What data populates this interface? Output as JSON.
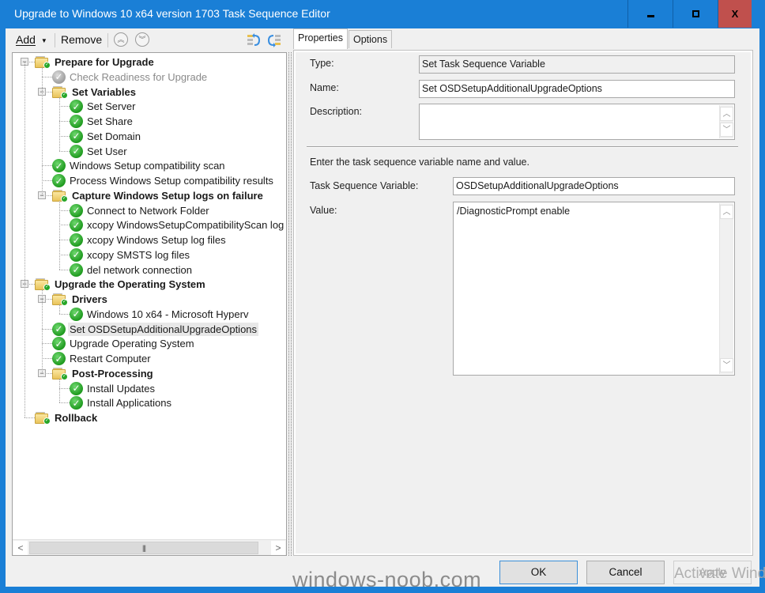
{
  "window": {
    "title": "Upgrade to Windows 10 x64 version 1703 Task Sequence Editor",
    "controls": {
      "minimize": "_",
      "maximize": "□",
      "close": "X"
    },
    "accent_color": "#1a7fd6",
    "close_color": "#c0504d"
  },
  "toolbar": {
    "add_label": "Add",
    "add_mnemonic": "A",
    "remove_label": "Remove",
    "remove_mnemonic": "R",
    "move_up_icon": "move-up-circle-icon",
    "move_down_icon": "move-down-circle-icon",
    "expand_icon": "expand-all-icon",
    "collapse_icon": "collapse-all-icon"
  },
  "tree": {
    "items": [
      {
        "label": "Prepare for Upgrade",
        "type": "group",
        "level": 0,
        "expanded": true
      },
      {
        "label": "Check Readiness for Upgrade",
        "type": "step",
        "level": 1,
        "disabled": true
      },
      {
        "label": "Set Variables",
        "type": "group",
        "level": 1,
        "expanded": true
      },
      {
        "label": "Set Server",
        "type": "step",
        "level": 2
      },
      {
        "label": "Set Share",
        "type": "step",
        "level": 2
      },
      {
        "label": "Set Domain",
        "type": "step",
        "level": 2
      },
      {
        "label": "Set User",
        "type": "step",
        "level": 2
      },
      {
        "label": "Windows Setup compatibility scan",
        "type": "step",
        "level": 1
      },
      {
        "label": "Process Windows Setup compatibility results",
        "type": "step",
        "level": 1
      },
      {
        "label": "Capture Windows Setup logs on failure",
        "type": "group",
        "level": 1,
        "expanded": true
      },
      {
        "label": "Connect to Network Folder",
        "type": "step",
        "level": 2
      },
      {
        "label": "xcopy WindowsSetupCompatibilityScan log files",
        "type": "step",
        "level": 2
      },
      {
        "label": "xcopy Windows Setup log files",
        "type": "step",
        "level": 2
      },
      {
        "label": "xcopy SMSTS log files",
        "type": "step",
        "level": 2
      },
      {
        "label": "del network connection",
        "type": "step",
        "level": 2
      },
      {
        "label": "Upgrade the Operating System",
        "type": "group",
        "level": 0,
        "expanded": true
      },
      {
        "label": "Drivers",
        "type": "group",
        "level": 1,
        "expanded": true
      },
      {
        "label": "Windows 10 x64 - Microsoft Hyperv",
        "type": "step",
        "level": 2
      },
      {
        "label": "Set OSDSetupAdditionalUpgradeOptions",
        "type": "step",
        "level": 1,
        "selected": true
      },
      {
        "label": "Upgrade Operating System",
        "type": "step",
        "level": 1
      },
      {
        "label": "Restart Computer",
        "type": "step",
        "level": 1
      },
      {
        "label": "Post-Processing",
        "type": "group",
        "level": 1,
        "expanded": true
      },
      {
        "label": "Install Updates",
        "type": "step",
        "level": 2
      },
      {
        "label": "Install Applications",
        "type": "step",
        "level": 2
      },
      {
        "label": "Rollback",
        "type": "group",
        "level": 0,
        "expanded": false
      }
    ]
  },
  "tabs": [
    {
      "label": "Properties",
      "active": true
    },
    {
      "label": "Options",
      "active": false
    }
  ],
  "properties": {
    "type_label": "Type:",
    "type_value": "Set Task Sequence Variable",
    "name_label": "Name:",
    "name_value": "Set OSDSetupAdditionalUpgradeOptions",
    "description_label": "Description:",
    "description_value": "",
    "instructions": "Enter the task sequence variable name and value.",
    "variable_label": "Task Sequence Variable:",
    "variable_value": "OSDSetupAdditionalUpgradeOptions",
    "value_label": "Value:",
    "value_value": "/DiagnosticPrompt enable"
  },
  "buttons": {
    "ok": "OK",
    "cancel": "Cancel",
    "apply": "Apply"
  },
  "overlays": {
    "watermark": "windows-noob.com",
    "activate_windows": "Activate Windows"
  }
}
